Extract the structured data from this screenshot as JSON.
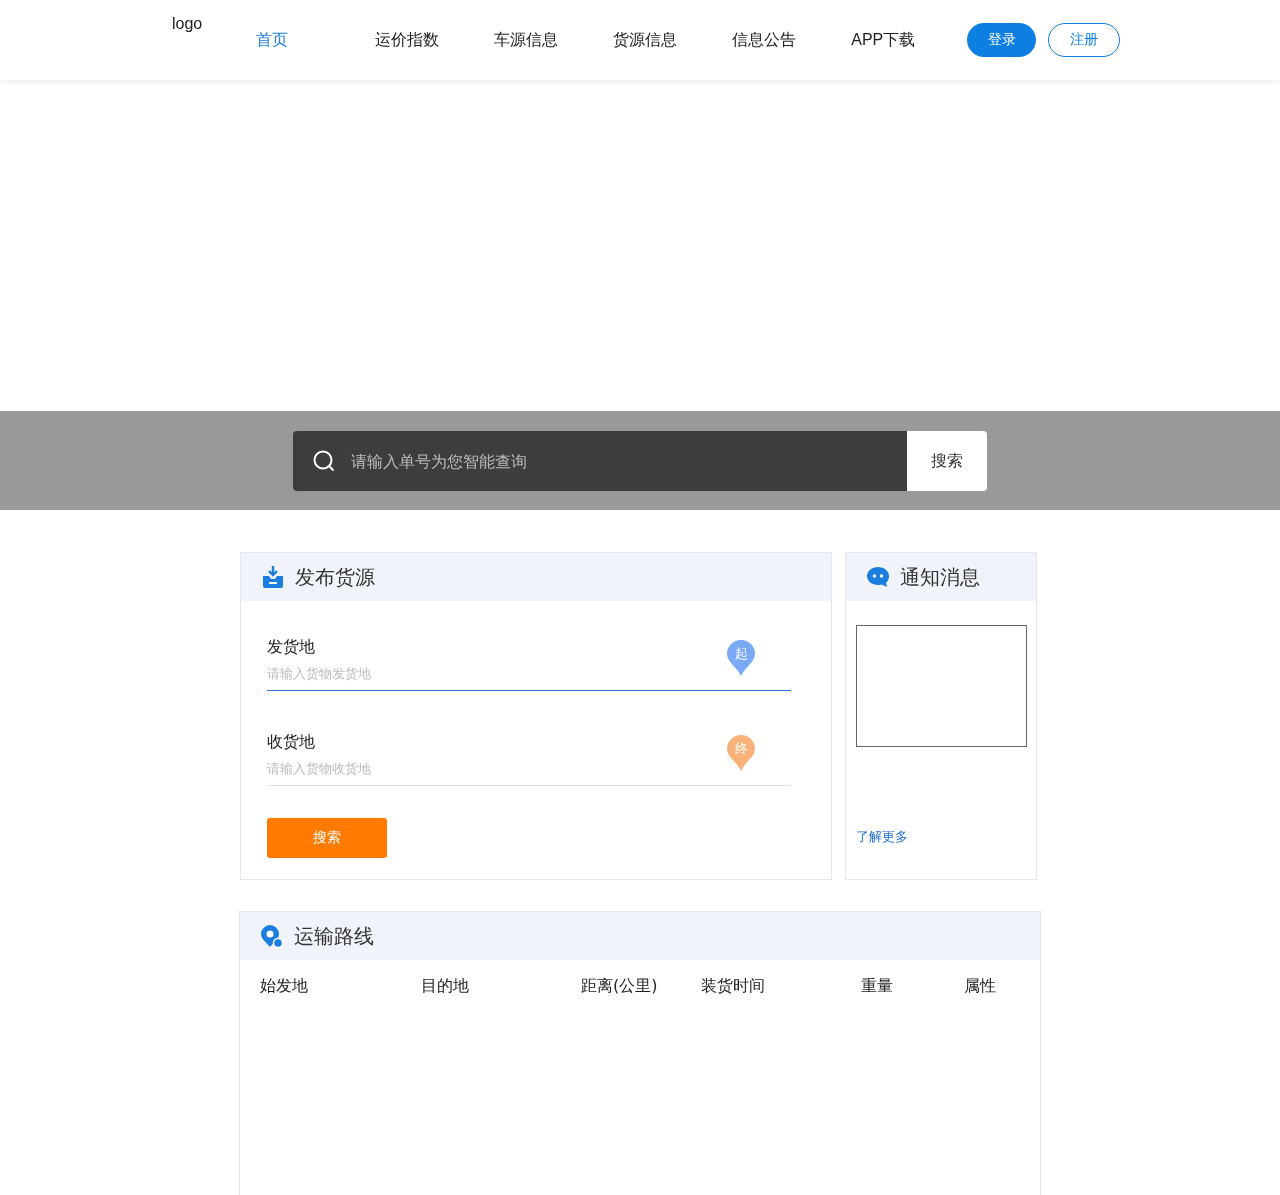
{
  "header": {
    "logo": "logo",
    "nav": [
      {
        "label": "首页",
        "selected": true
      },
      {
        "label": "运价指数",
        "selected": false
      },
      {
        "label": "车源信息",
        "selected": false
      },
      {
        "label": "货源信息",
        "selected": false
      },
      {
        "label": "信息公告",
        "selected": false
      },
      {
        "label": "APP下载",
        "selected": false
      }
    ],
    "buttons": [
      {
        "label": "登录",
        "kind": "primary"
      },
      {
        "label": "注册",
        "kind": "outline"
      }
    ]
  },
  "search": {
    "placeholder": "请输入单号为您智能查询",
    "button": "搜索"
  },
  "publish": {
    "title": "发布货源",
    "fields": [
      {
        "label": "发货地",
        "placeholder": "请输入货物发货地",
        "pin": "起",
        "color": "#7aa9f7",
        "focused": true
      },
      {
        "label": "收货地",
        "placeholder": "请输入货物收货地",
        "pin": "终",
        "color": "#f8b27a",
        "focused": false
      }
    ],
    "button": "搜索"
  },
  "notice": {
    "title": "通知消息",
    "link": "了解更多"
  },
  "routes": {
    "title": "运输路线",
    "columns": [
      "始发地",
      "目的地",
      "距离(公里)",
      "装货时间",
      "重量",
      "属性"
    ]
  }
}
